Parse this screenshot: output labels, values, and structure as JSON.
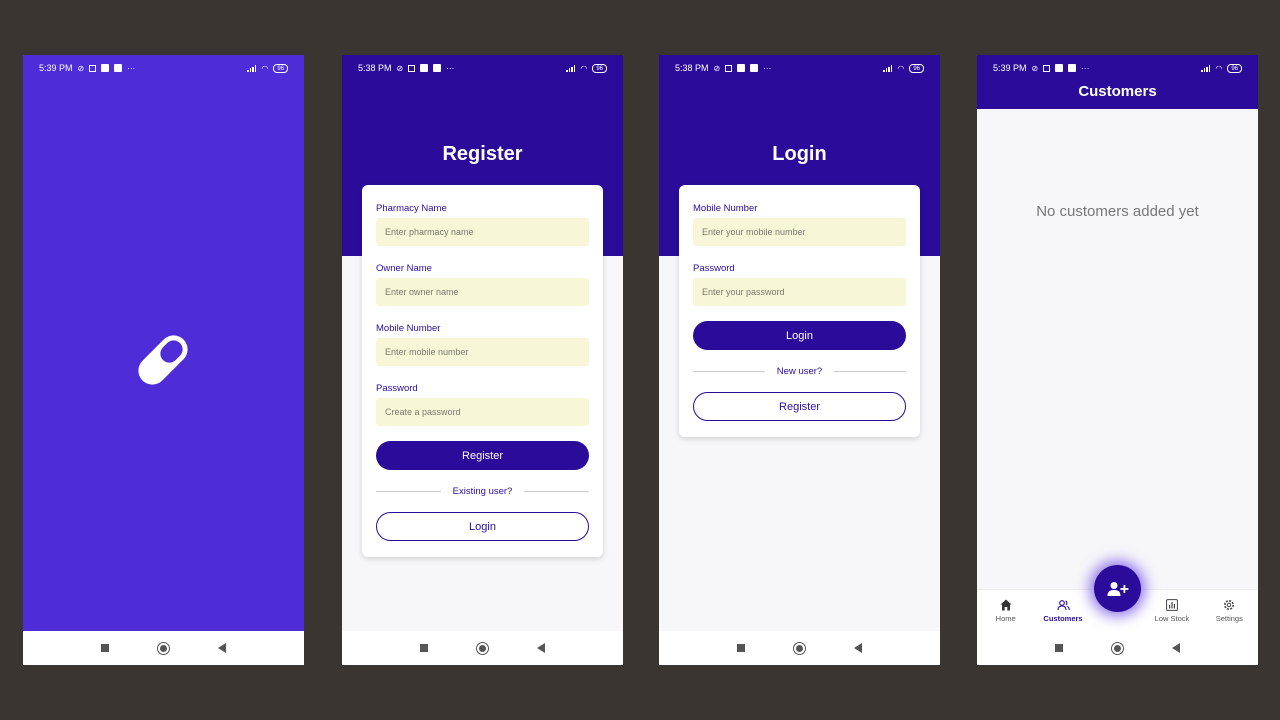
{
  "colors": {
    "primary": "#2b0c9a",
    "splash": "#4e2cd8",
    "input_bg": "#f7f6d6",
    "backdrop": "#3a3530"
  },
  "screens": [
    {
      "status_time": "5:39 PM",
      "battery": "96"
    },
    {
      "status_time": "5:38 PM",
      "battery": "96"
    },
    {
      "status_time": "5:38 PM",
      "battery": "96"
    },
    {
      "status_time": "5:39 PM",
      "battery": "96"
    }
  ],
  "splash": {
    "icon": "pill-icon"
  },
  "register": {
    "title": "Register",
    "fields": [
      {
        "label": "Pharmacy Name",
        "placeholder": "Enter pharmacy name"
      },
      {
        "label": "Owner Name",
        "placeholder": "Enter owner name"
      },
      {
        "label": "Mobile Number",
        "placeholder": "Enter mobile number"
      },
      {
        "label": "Password",
        "placeholder": "Create a password"
      }
    ],
    "submit_label": "Register",
    "divider_text": "Existing user?",
    "alt_label": "Login"
  },
  "login": {
    "title": "Login",
    "fields": [
      {
        "label": "Mobile Number",
        "placeholder": "Enter your mobile number"
      },
      {
        "label": "Password",
        "placeholder": "Enter your password"
      }
    ],
    "submit_label": "Login",
    "divider_text": "New user?",
    "alt_label": "Register"
  },
  "customers": {
    "title": "Customers",
    "empty_message": "No customers added yet",
    "fab_icon": "add-user-icon",
    "tabs": [
      {
        "label": "Home",
        "icon": "home-icon"
      },
      {
        "label": "Customers",
        "icon": "users-icon",
        "active": true
      },
      {
        "label": "Low Stock",
        "icon": "chart-icon"
      },
      {
        "label": "Settings",
        "icon": "gear-icon"
      }
    ]
  }
}
